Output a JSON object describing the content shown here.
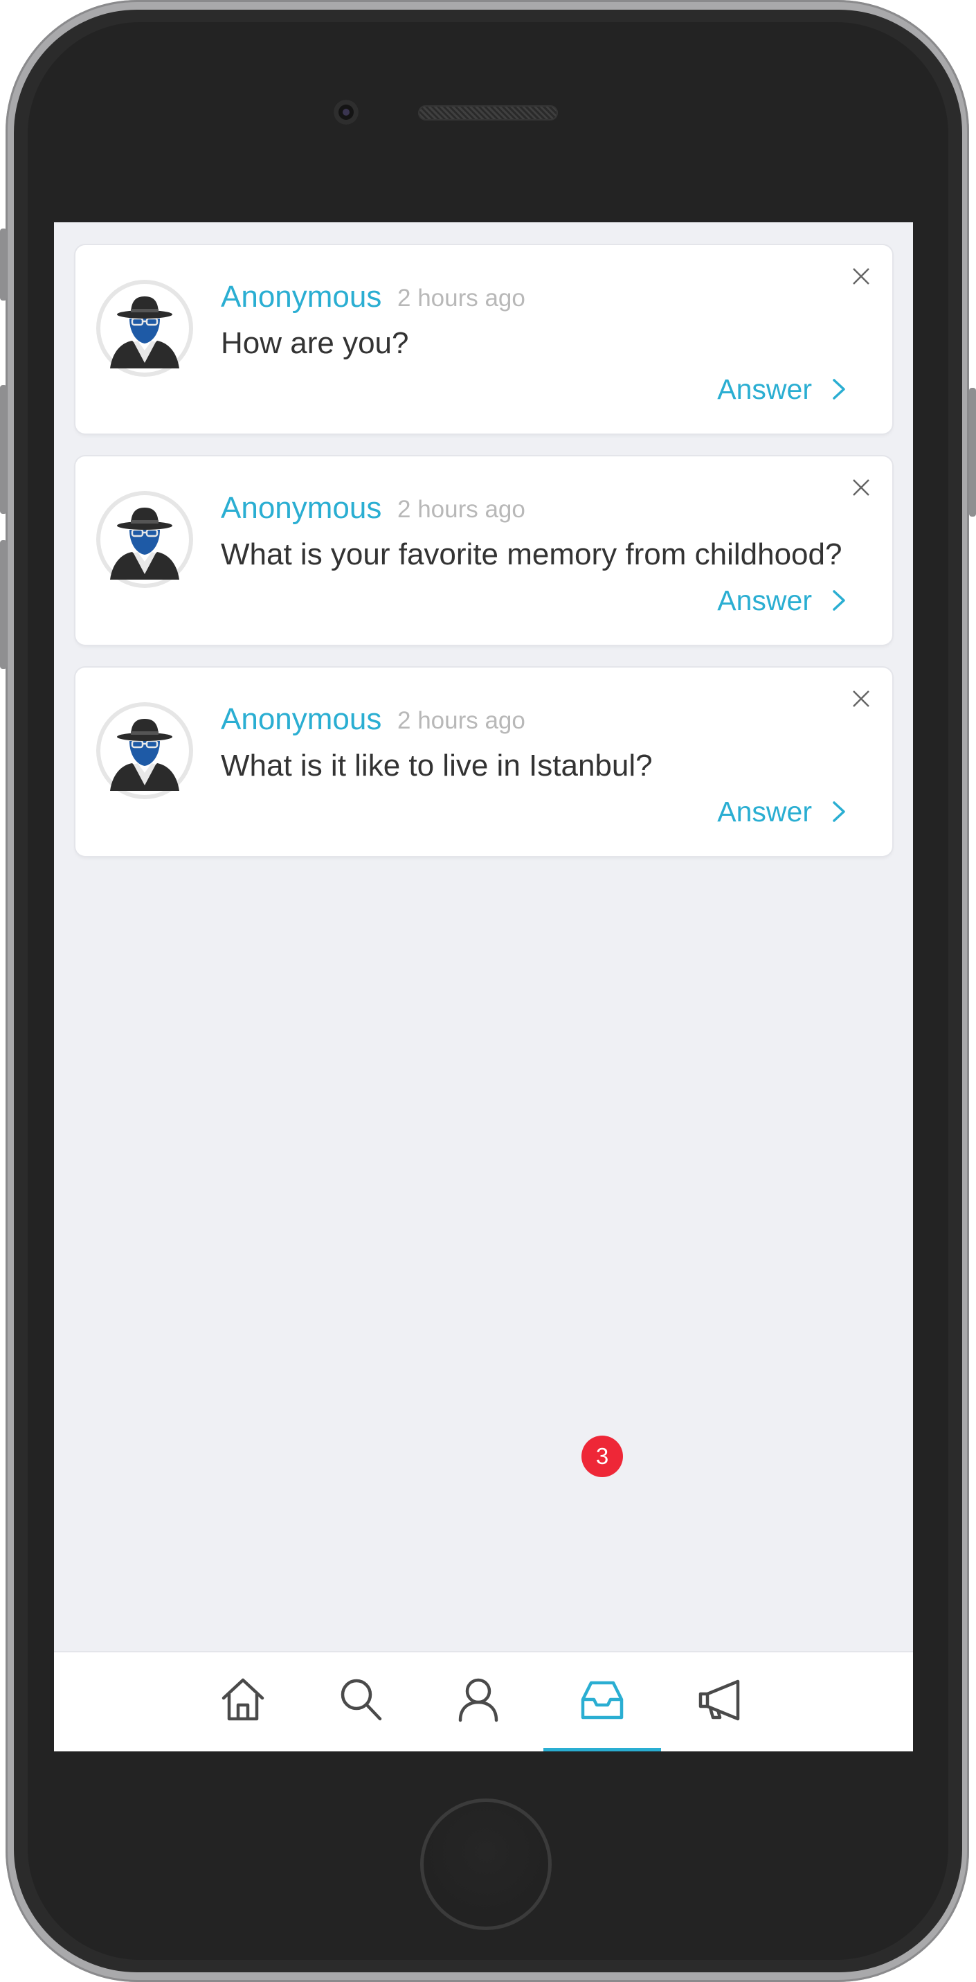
{
  "feed": {
    "questions": [
      {
        "author": "Anonymous",
        "time": "2 hours ago",
        "text": "How are you?",
        "answer_label": "Answer"
      },
      {
        "author": "Anonymous",
        "time": "2 hours ago",
        "text": "What is your favorite memory from childhood?",
        "answer_label": "Answer"
      },
      {
        "author": "Anonymous",
        "time": "2 hours ago",
        "text": "What is it like to live in Istanbul?",
        "answer_label": "Answer"
      }
    ]
  },
  "tabbar": {
    "tabs": [
      {
        "icon": "home-icon"
      },
      {
        "icon": "search-icon"
      },
      {
        "icon": "profile-icon"
      },
      {
        "icon": "inbox-icon",
        "active": true
      },
      {
        "icon": "megaphone-icon"
      }
    ],
    "inbox_badge": "3"
  },
  "colors": {
    "accent": "#2aaed2",
    "badge": "#ee2737",
    "screen_background": "#eff0f4",
    "avatar_mask": "#1e5aa6"
  }
}
